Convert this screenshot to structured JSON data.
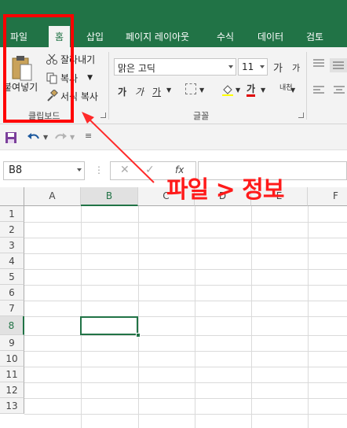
{
  "ribbon_tabs": [
    "파일",
    "홈",
    "삽입",
    "페이지 레이아웃",
    "수식",
    "데이터",
    "검토"
  ],
  "active_tab": "홈",
  "clipboard": {
    "paste_label": "붙여넣기",
    "cut_label": "잘라내기",
    "copy_label": "복사",
    "format_painter_label": "서식 복사",
    "group_label": "클립보드"
  },
  "font_group": {
    "font_name": "맑은 고딕",
    "font_size": "11",
    "bold_label": "가",
    "italic_label": "가",
    "underline_label": "가",
    "font_color_label": "가",
    "phonetic_label": "내천",
    "grow_label": "가",
    "shrink_label": "가",
    "group_label": "글꼴"
  },
  "formula_bar": {
    "name_box": "B8",
    "fx_label": "fx",
    "formula": ""
  },
  "columns": [
    "A",
    "B",
    "C",
    "D",
    "E",
    "F"
  ],
  "rows": [
    "1",
    "2",
    "3",
    "4",
    "5",
    "6",
    "7",
    "8",
    "9",
    "10",
    "11",
    "12",
    "13"
  ],
  "selected_cell": "B8",
  "annotation": {
    "text": "파일 > 정보"
  },
  "colors": {
    "excel_green": "#217346",
    "annotation_red": "#ff0000"
  }
}
